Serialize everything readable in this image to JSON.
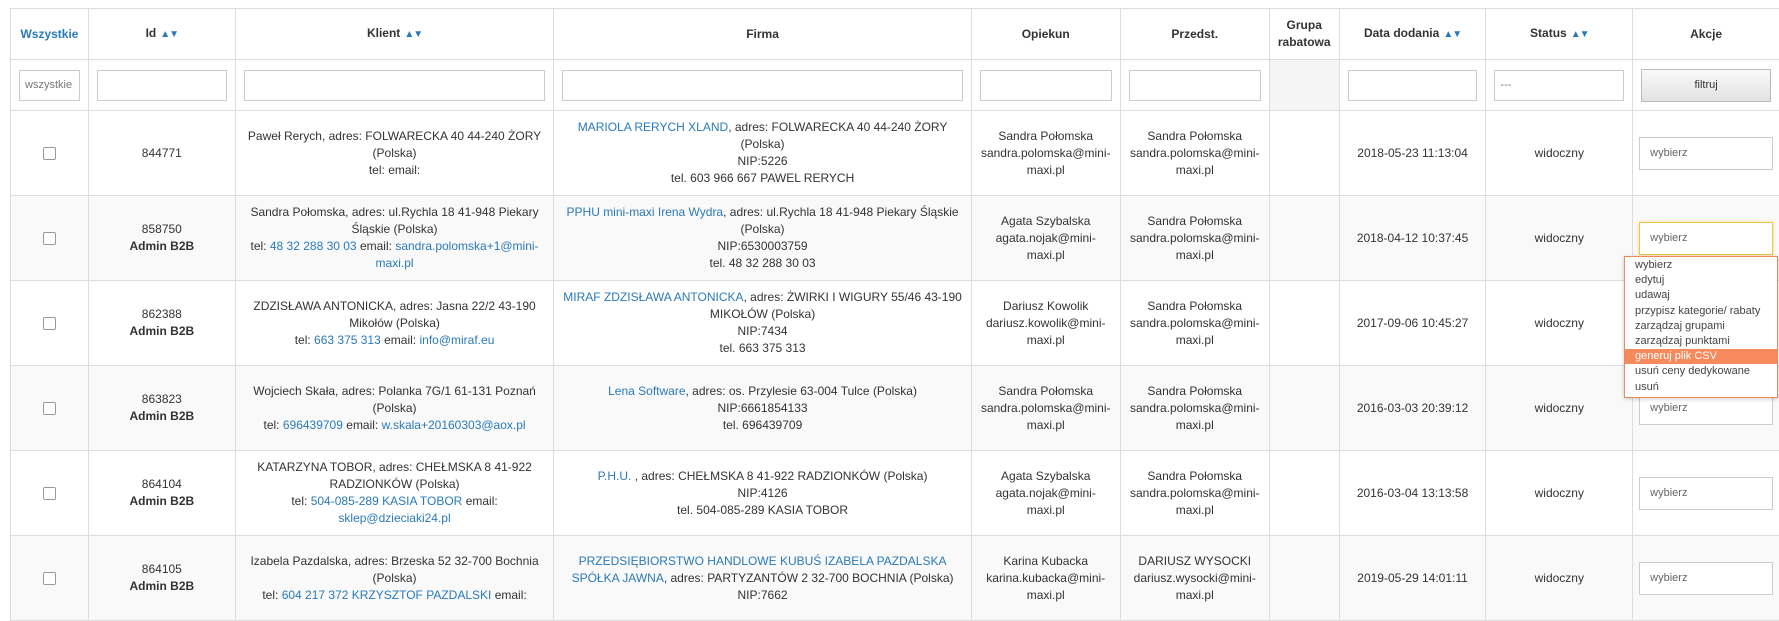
{
  "headers": {
    "select_all": "Wszystkie",
    "id": "Id",
    "klient": "Klient",
    "firma": "Firma",
    "opiekun": "Opiekun",
    "przedst": "Przedst.",
    "grupa": "Grupa rabatowa",
    "data": "Data dodania",
    "status": "Status",
    "akcje": "Akcje",
    "sort_arrows": "▲▼"
  },
  "filters": {
    "select_value": "wszystkie",
    "status_value": "---",
    "button": "filtruj"
  },
  "rows": [
    {
      "id": "844771",
      "role": "",
      "klient": {
        "text": "Paweł Rerych, adres: FOLWARECKA 40 44-240 ŻORY (Polska)",
        "tel_label": "tel:",
        "tel": "",
        "email_label": "email:",
        "email": ""
      },
      "firma": {
        "name": "MARIOLA RERYCH XLAND",
        "addr": ", adres: FOLWARECKA 40 44-240 ŻORY (Polska)",
        "nip": "NIP:5226",
        "tel": "tel. 603 966 667 PAWEL RERYCH"
      },
      "opiekun": {
        "name": "Sandra Połomska",
        "email": "sandra.polomska@mini-maxi.pl"
      },
      "przedst": {
        "name": "Sandra Połomska",
        "email": "sandra.polomska@mini-maxi.pl"
      },
      "data": "2018-05-23 11:13:04",
      "status": "widoczny",
      "akcja": "wybierz"
    },
    {
      "id": "858750",
      "role": "Admin B2B",
      "klient": {
        "text": "Sandra Połomska, adres: ul.Rychla 18 41-948 Piekary Śląskie (Polska)",
        "tel_label": "tel:",
        "tel": "48 32 288 30 03",
        "email_label": "email:",
        "email": "sandra.polomska+1@mini-maxi.pl"
      },
      "firma": {
        "name": "PPHU mini-maxi Irena Wydra",
        "addr": ", adres: ul.Rychla 18 41-948 Piekary Śląskie (Polska)",
        "nip": "NIP:6530003759",
        "tel": "tel. 48 32 288 30 03"
      },
      "opiekun": {
        "name": "Agata Szybalska",
        "email": "agata.nojak@mini-maxi.pl"
      },
      "przedst": {
        "name": "Sandra Połomska",
        "email": "sandra.polomska@mini-maxi.pl"
      },
      "data": "2018-04-12 10:37:45",
      "status": "widoczny",
      "akcja": "wybierz"
    },
    {
      "id": "862388",
      "role": "Admin B2B",
      "klient": {
        "text": "ZDZISŁAWA ANTONICKA, adres: Jasna 22/2 43-190 Mikołów (Polska)",
        "tel_label": "tel:",
        "tel": "663 375 313",
        "email_label": "email:",
        "email": "info@miraf.eu"
      },
      "firma": {
        "name": "MIRAF ZDZISŁAWA ANTONICKA",
        "addr": ", adres: ŻWIRKI I WIGURY 55/46 43-190 MIKOŁÓW (Polska)",
        "nip": "NIP:7434",
        "tel": "tel. 663 375 313"
      },
      "opiekun": {
        "name": "Dariusz Kowolik",
        "email": "dariusz.kowolik@mini-maxi.pl"
      },
      "przedst": {
        "name": "Sandra Połomska",
        "email": "sandra.polomska@mini-maxi.pl"
      },
      "data": "2017-09-06 10:45:27",
      "status": "widoczny",
      "akcja": "wybierz"
    },
    {
      "id": "863823",
      "role": "Admin B2B",
      "klient": {
        "text": "Wojciech Skała, adres: Polanka 7G/1 61-131 Poznań (Polska)",
        "tel_label": "tel:",
        "tel": "696439709",
        "email_label": "email:",
        "email": "w.skala+20160303@aox.pl"
      },
      "firma": {
        "name": "Lena Software",
        "addr": ", adres: os. Przylesie 63-004 Tulce (Polska)",
        "nip": "NIP:6661854133",
        "tel": "tel. 696439709"
      },
      "opiekun": {
        "name": "Sandra Połomska",
        "email": "sandra.polomska@mini-maxi.pl"
      },
      "przedst": {
        "name": "Sandra Połomska",
        "email": "sandra.polomska@mini-maxi.pl"
      },
      "data": "2016-03-03 20:39:12",
      "status": "widoczny",
      "akcja": "wybierz"
    },
    {
      "id": "864104",
      "role": "Admin B2B",
      "klient": {
        "text": "KATARZYNA TOBOR, adres: CHEŁMSKA 8 41-922 RADZIONKÓW (Polska)",
        "tel_label": "tel:",
        "tel": "504-085-289 KASIA TOBOR",
        "email_label": "email:",
        "email": "sklep@dzieciaki24.pl"
      },
      "firma": {
        "name": "P.H.U. ",
        "addr": ", adres: CHEŁMSKA 8 41-922 RADZIONKÓW (Polska)",
        "nip": "NIP:4126",
        "tel": "tel. 504-085-289 KASIA TOBOR"
      },
      "opiekun": {
        "name": "Agata Szybalska",
        "email": "agata.nojak@mini-maxi.pl"
      },
      "przedst": {
        "name": "Sandra Połomska",
        "email": "sandra.polomska@mini-maxi.pl"
      },
      "data": "2016-03-04 13:13:58",
      "status": "widoczny",
      "akcja": "wybierz"
    },
    {
      "id": "864105",
      "role": "Admin B2B",
      "klient": {
        "text": "Izabela Pazdalska, adres: Brzeska 52 32-700 Bochnia (Polska)",
        "tel_label": "tel:",
        "tel": "604 217 372 KRZYSZTOF PAZDALSKI",
        "email_label": "email:",
        "email": ""
      },
      "firma": {
        "name": "PRZEDSIĘBIORSTWO HANDLOWE KUBUŚ IZABELA PAZDALSKA SPÓŁKA JAWNA",
        "addr": ", adres: PARTYZANTÓW 2 32-700 BOCHNIA (Polska)",
        "nip": "NIP:7662",
        "tel": ""
      },
      "opiekun": {
        "name": "Karina Kubacka",
        "email": "karina.kubacka@mini-maxi.pl"
      },
      "przedst": {
        "name": "DARIUSZ WYSOCKI",
        "email": "dariusz.wysocki@mini-maxi.pl"
      },
      "data": "2019-05-29 14:01:11",
      "status": "widoczny",
      "akcja": "wybierz"
    }
  ],
  "dropdown": {
    "options": [
      "wybierz",
      "edytuj",
      "udawaj",
      "przypisz kategorie/ rabaty",
      "zarządzaj grupami",
      "zarządzaj punktami",
      "generuj plik CSV",
      "usuń ceny dedykowane",
      "usuń"
    ],
    "highlighted": "generuj plik CSV"
  }
}
